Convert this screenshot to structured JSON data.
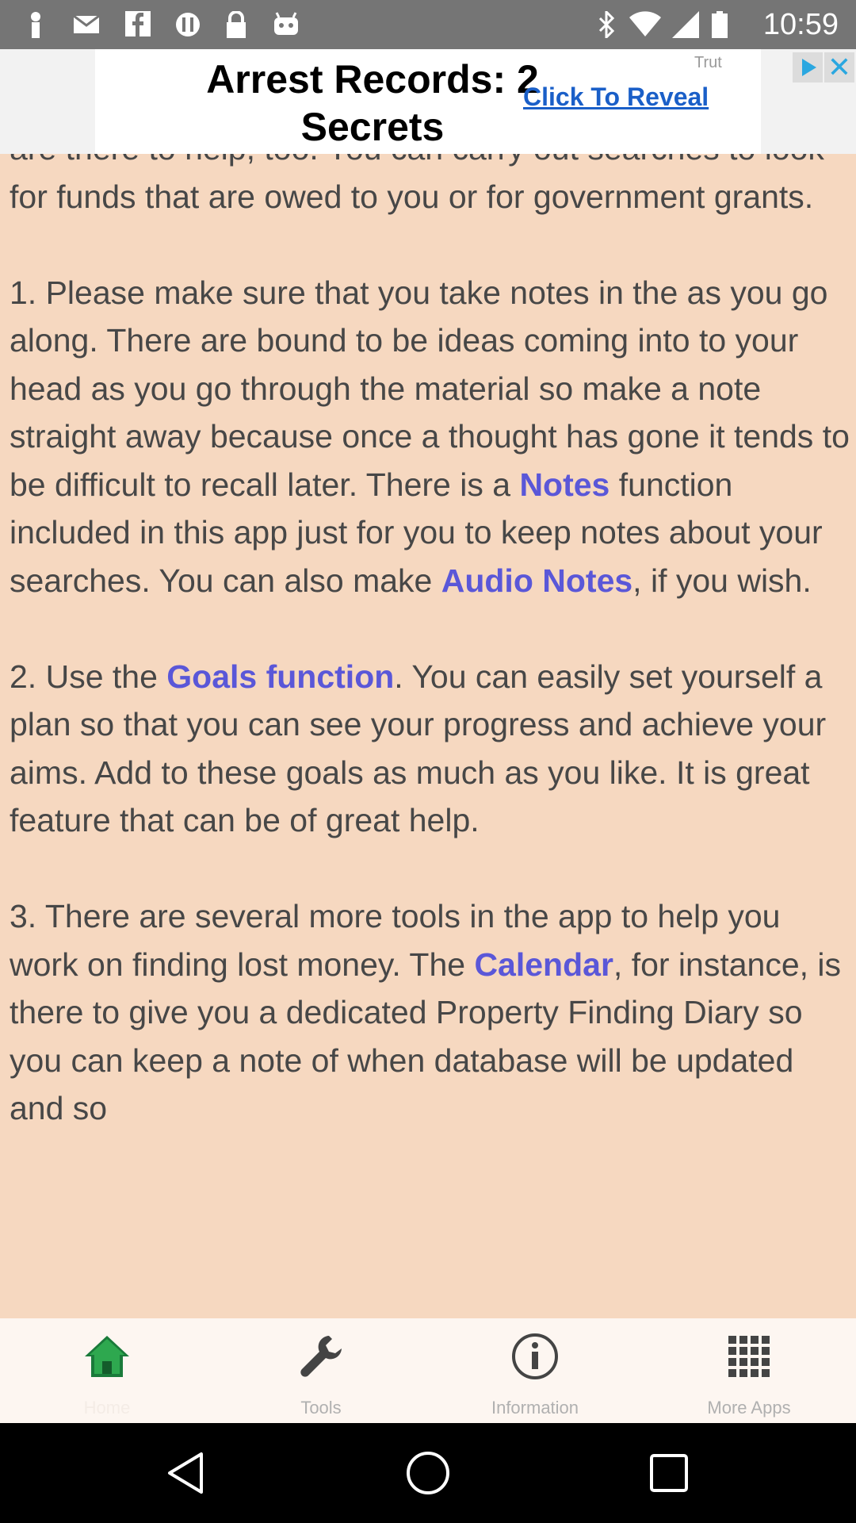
{
  "status_bar": {
    "time": "10:59",
    "icons": [
      "notification-icon",
      "mail-icon",
      "facebook-icon",
      "sync-icon",
      "lock-icon",
      "android-icon",
      "bluetooth-icon",
      "wifi-icon",
      "signal-icon",
      "battery-icon"
    ]
  },
  "ad": {
    "title_line1": "Arrest Records: 2",
    "title_line2": "Secrets",
    "cta": "Click To Reveal",
    "badge": "Trut"
  },
  "content": {
    "para0": "are there to help, too. You can carry out searches to look for funds that are owed to you or for government grants.",
    "p1_a": "1. Please make sure that you take notes in the as you go along. There are bound to be ideas coming into to your head as you go through the material so make a note straight away because once a thought has gone it tends to be difficult to recall later.  There is a ",
    "p1_hl1": "Notes",
    "p1_b": " function included in this app just for you to keep notes about your searches. You can also make ",
    "p1_hl2": "Audio Notes",
    "p1_c": ", if you wish.",
    "p2_a": "2. Use the ",
    "p2_hl": "Goals function",
    "p2_b": ". You can easily set yourself a plan so that you can see your progress and achieve your aims. Add to these goals as much as you like. It is great feature that can be of great help.",
    "p3_a": "3. There are several more tools in the app to help you work on finding lost money.  The ",
    "p3_hl": "Calendar",
    "p3_b": ", for instance, is there to give you a dedicated Property Finding Diary so you can keep a note of when database will be updated and so"
  },
  "tabs": [
    {
      "label": "Home",
      "icon": "home-icon"
    },
    {
      "label": "Tools",
      "icon": "wrench-icon"
    },
    {
      "label": "Information",
      "icon": "info-icon"
    },
    {
      "label": "More Apps",
      "icon": "grid-icon"
    }
  ],
  "colors": {
    "content_bg": "#f6d8c0",
    "highlight": "#5a57d8",
    "text": "#474747",
    "tab_bg": "#fdf6f1"
  }
}
